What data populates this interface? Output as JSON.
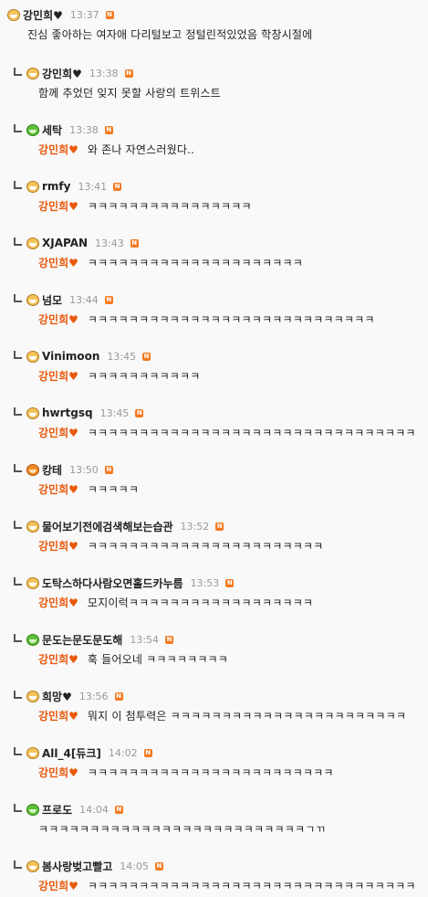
{
  "comments": [
    {
      "nick": "강민희♥",
      "time": "13:37",
      "avatar": "orange",
      "reply": false,
      "mention": "",
      "text": "진심 좋아하는 여자애 다리털보고 정털린적있었음 학창시절에"
    },
    {
      "nick": "강민희♥",
      "time": "13:38",
      "avatar": "orange",
      "reply": true,
      "mention": "",
      "text": "함께 추었던 잊지 못할 사랑의 트위스트"
    },
    {
      "nick": "세탁",
      "time": "13:38",
      "avatar": "green",
      "reply": true,
      "mention": "강민희♥",
      "text": "와 존나 자연스러웠다.."
    },
    {
      "nick": "rmfy",
      "time": "13:41",
      "avatar": "orange",
      "reply": true,
      "mention": "강민희♥",
      "text": "ㅋㅋㅋㅋㅋㅋㅋㅋㅋㅋㅋㅋㅋㅋㅋㅋ"
    },
    {
      "nick": "XJAPAN",
      "time": "13:43",
      "avatar": "orange",
      "reply": true,
      "mention": "강민희♥",
      "text": "ㅋㅋㅋㅋㅋㅋㅋㅋㅋㅋㅋㅋㅋㅋㅋㅋㅋㅋㅋㅋㅋ"
    },
    {
      "nick": "넘모",
      "time": "13:44",
      "avatar": "orange",
      "reply": true,
      "mention": "강민희♥",
      "text": "ㅋㅋㅋㅋㅋㅋㅋㅋㅋㅋㅋㅋㅋㅋㅋㅋㅋㅋㅋㅋㅋㅋㅋㅋㅋㅋㅋㅋ"
    },
    {
      "nick": "Vinimoon",
      "time": "13:45",
      "avatar": "orange",
      "reply": true,
      "mention": "강민희♥",
      "text": "ㅋㅋㅋㅋㅋㅋㅋㅋㅋㅋㅋ"
    },
    {
      "nick": "hwrtgsq",
      "time": "13:45",
      "avatar": "orange",
      "reply": true,
      "mention": "강민희♥",
      "text": "ㅋㅋㅋㅋㅋㅋㅋㅋㅋㅋㅋㅋㅋㅋㅋㅋㅋㅋㅋㅋㅋㅋㅋㅋㅋㅋㅋㅋㅋㅋㅋㅋ"
    },
    {
      "nick": "캉테",
      "time": "13:50",
      "avatar": "tiger",
      "reply": true,
      "mention": "강민희♥",
      "text": "ㅋㅋㅋㅋㅋ"
    },
    {
      "nick": "물어보기전에검색해보는습관",
      "time": "13:52",
      "avatar": "orange",
      "reply": true,
      "mention": "강민희♥",
      "text": "ㅋㅋㅋㅋㅋㅋㅋㅋㅋㅋㅋㅋㅋㅋㅋㅋㅋㅋㅋㅋㅋㅋㅋ"
    },
    {
      "nick": "도탁스하다사람오면홀드카누름",
      "time": "13:53",
      "avatar": "orange",
      "reply": true,
      "mention": "강민희♥",
      "text": "모지이럭ㅋㅋㅋㅋㅋㅋㅋㅋㅋㅋㅋㅋㅋㅋㅋㅋㅋㅋ"
    },
    {
      "nick": "문도는문도문도해",
      "time": "13:54",
      "avatar": "green",
      "reply": true,
      "mention": "강민희♥",
      "text": "훅 들어오네 ㅋㅋㅋㅋㅋㅋㅋㅋ"
    },
    {
      "nick": "희망♥",
      "time": "13:56",
      "avatar": "orange",
      "reply": true,
      "mention": "강민희♥",
      "text": "뭐지 이 첨투력은 ㅋㅋㅋㅋㅋㅋㅋㅋㅋㅋㅋㅋㅋㅋㅋㅋㅋㅋㅋㅋㅋㅋㅋ"
    },
    {
      "nick": "All_4[듀크]",
      "time": "14:02",
      "avatar": "orange",
      "reply": true,
      "mention": "강민희♥",
      "text": "ㅋㅋㅋㅋㅋㅋㅋㅋㅋㅋㅋㅋㅋㅋㅋㅋㅋㅋㅋㅋㅋㅋㅋㅋ"
    },
    {
      "nick": "프로도",
      "time": "14:04",
      "avatar": "green",
      "reply": true,
      "mention": "",
      "text": "ㅋㅋㅋㅋㅋㅋㅋㅋㅋㅋㅋㅋㅋㅋㅋㅋㅋㅋㅋㅋㅋㅋㅋㅋㅋㅋㄱㄲ"
    },
    {
      "nick": "봄사랑벚고빨고",
      "time": "14:05",
      "avatar": "orange",
      "reply": true,
      "mention": "강민희♥",
      "text": "ㅋㅋㅋㅋㅋㅋㅋㅋㅋㅋㅋㅋㅋㅋㅋㅋㅋㅋㅋㅋㅋㅋㅋㅋㅋㅋㅋㅋㅋㅋㅋㅋ"
    }
  ],
  "badge_label": "N",
  "colors": {
    "mention": "#e8590c",
    "badge": "#f47a20",
    "time": "#999999"
  }
}
